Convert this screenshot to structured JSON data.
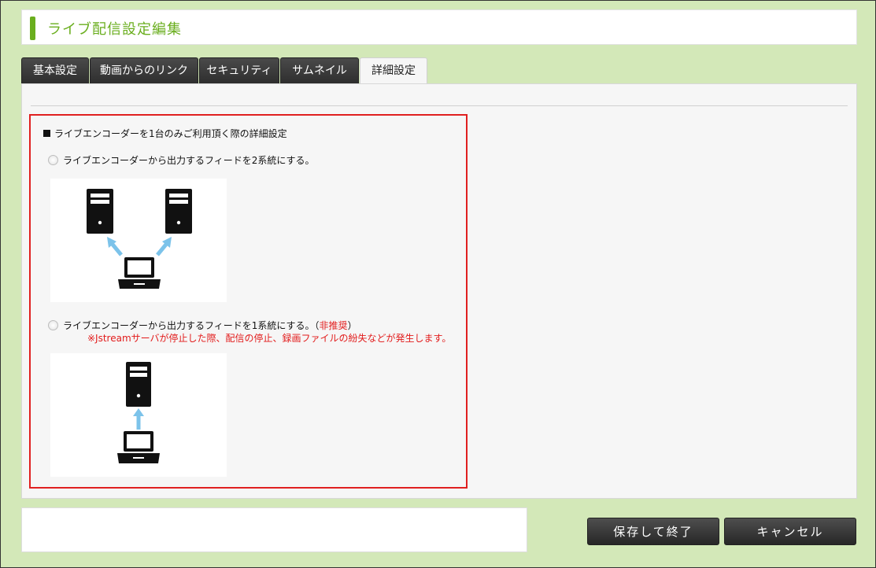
{
  "page": {
    "title": "ライブ配信設定編集"
  },
  "tabs": [
    {
      "label": "基本設定"
    },
    {
      "label": "動画からのリンク"
    },
    {
      "label": "セキュリティ"
    },
    {
      "label": "サムネイル"
    },
    {
      "label": "詳細設定",
      "active": true
    }
  ],
  "section": {
    "heading": "ライブエンコーダーを1台のみご利用頂く際の詳細設定",
    "option1": {
      "label": "ライブエンコーダーから出力するフィードを2系統にする。"
    },
    "option2": {
      "label": "ライブエンコーダーから出力するフィードを1系統にする。",
      "suffix_open": "（",
      "note": "非推奨",
      "suffix_close": "）",
      "warning": "※Jstreamサーバが停止した際、配信の停止、録画ファイルの紛失などが発生します。"
    }
  },
  "buttons": {
    "save": "保存して終了",
    "cancel": "キャンセル"
  },
  "colors": {
    "accent": "#6aae1e",
    "background": "#d3e8b8",
    "highlight": "#e02020",
    "arrow": "#7cc3ea"
  }
}
